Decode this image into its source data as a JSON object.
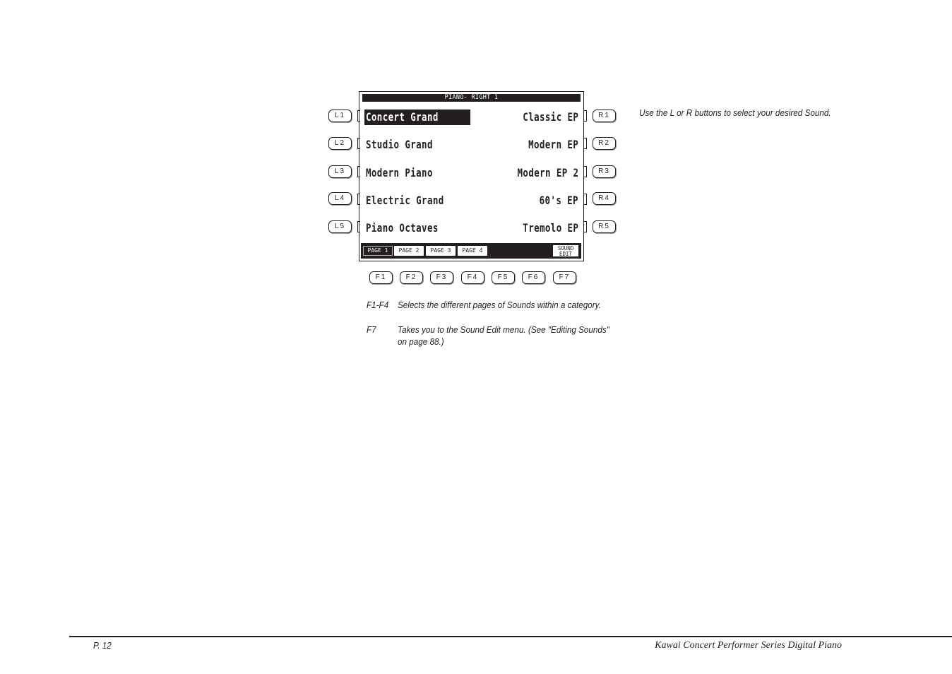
{
  "lcd": {
    "title": "PIANO- RIGHT 1",
    "left_sounds": [
      "Concert Grand",
      "Studio Grand",
      "Modern Piano",
      "Electric Grand",
      "Piano Octaves"
    ],
    "right_sounds": [
      "Classic EP",
      "Modern EP",
      "Modern EP 2",
      "60's EP",
      "Tremolo EP"
    ],
    "selected_sound": "Concert Grand",
    "page_tabs": [
      "PAGE 1",
      "PAGE 2",
      "PAGE 3",
      "PAGE 4"
    ],
    "active_page": "PAGE 1",
    "sound_edit_line1": "SOUND",
    "sound_edit_line2": "EDIT"
  },
  "left_buttons": [
    "L1",
    "L2",
    "L3",
    "L4",
    "L5"
  ],
  "right_buttons": [
    "R1",
    "R2",
    "R3",
    "R4",
    "R5"
  ],
  "function_buttons": [
    "F1",
    "F2",
    "F3",
    "F4",
    "F5",
    "F6",
    "F7"
  ],
  "side_note": "Use the L or R buttons to select your desired Sound.",
  "notes": [
    {
      "key": "F1-F4",
      "text": "Selects the different pages of Sounds within a category."
    },
    {
      "key": "F7",
      "text_line1": "Takes you to the Sound Edit menu.  (See \"Editing Sounds\"",
      "text_line2": "on page 88.)"
    }
  ],
  "footer": {
    "page_number": "P. 12",
    "book_title": "Kawai Concert Performer Series Digital Piano"
  }
}
